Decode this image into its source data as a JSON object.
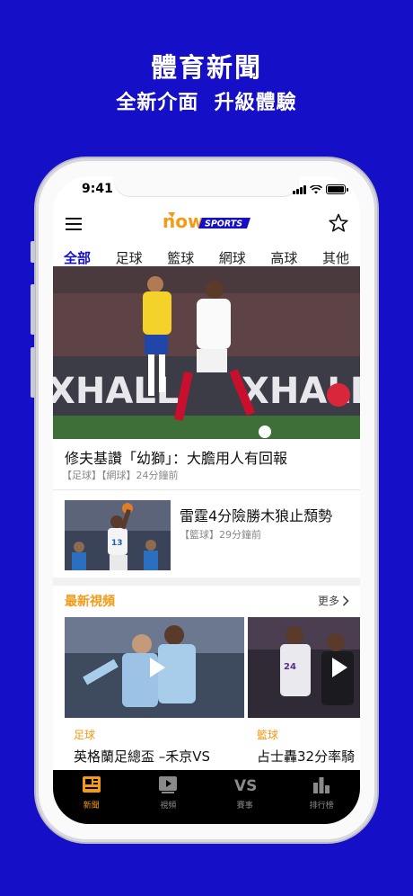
{
  "promo": {
    "title": "體育新聞",
    "subtitle": "全新介面  升級體驗"
  },
  "status_bar": {
    "time": "9:41"
  },
  "header": {
    "logo_text": "now",
    "logo_badge": "SPORTS",
    "menu_icon": "hamburger-menu-icon",
    "favorite_icon": "star-icon"
  },
  "tabs": [
    {
      "label": "全部",
      "active": true
    },
    {
      "label": "足球",
      "active": false
    },
    {
      "label": "籃球",
      "active": false
    },
    {
      "label": "網球",
      "active": false
    },
    {
      "label": "高球",
      "active": false
    },
    {
      "label": "其他",
      "active": false
    }
  ],
  "hero_article": {
    "title": "修夫基讚「幼獅」：大膽用人有回報",
    "tags": "【足球】【網球】24分鐘前"
  },
  "article_2": {
    "title": "雷霆4分險勝木狼止頹勢",
    "tags": "【籃球】29分鐘前"
  },
  "video_section": {
    "label": "最新視頻",
    "more_label": "更多",
    "videos": [
      {
        "category": "足球",
        "title": "英格蘭足總盃 –禾京VS"
      },
      {
        "category": "籃球",
        "title": "占士轟32分率騎"
      }
    ]
  },
  "bottom_nav": [
    {
      "label": "新聞",
      "icon": "newspaper-icon",
      "active": true
    },
    {
      "label": "視頻",
      "icon": "video-icon",
      "active": false
    },
    {
      "label": "賽事",
      "icon": "vs-icon",
      "active": false
    },
    {
      "label": "排行榜",
      "icon": "bar-chart-icon",
      "active": false
    }
  ],
  "colors": {
    "background": "#1510c8",
    "accent_orange": "#f39a16",
    "active_tab": "#1510c8"
  }
}
